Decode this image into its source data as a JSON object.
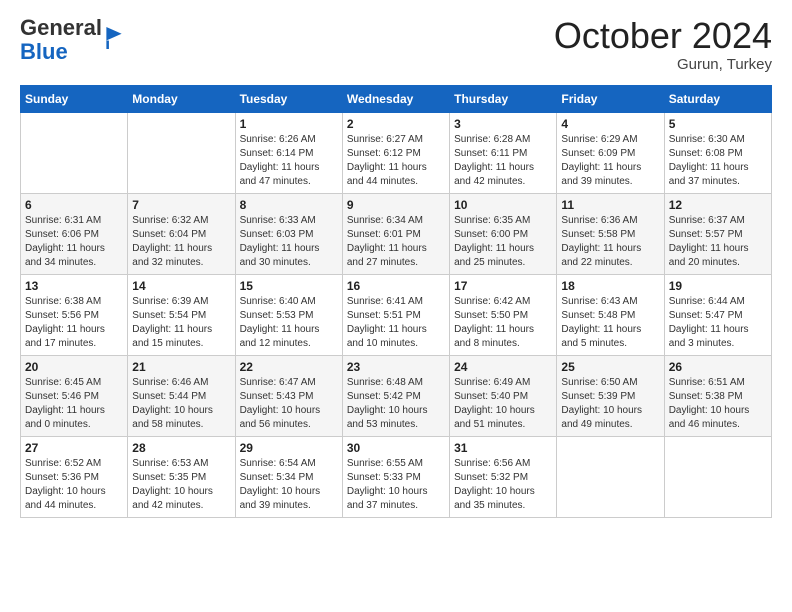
{
  "logo": {
    "general": "General",
    "blue": "Blue"
  },
  "header": {
    "month": "October 2024",
    "location": "Gurun, Turkey"
  },
  "weekdays": [
    "Sunday",
    "Monday",
    "Tuesday",
    "Wednesday",
    "Thursday",
    "Friday",
    "Saturday"
  ],
  "weeks": [
    [
      {
        "day": "",
        "sunrise": "",
        "sunset": "",
        "daylight": ""
      },
      {
        "day": "",
        "sunrise": "",
        "sunset": "",
        "daylight": ""
      },
      {
        "day": "1",
        "sunrise": "Sunrise: 6:26 AM",
        "sunset": "Sunset: 6:14 PM",
        "daylight": "Daylight: 11 hours and 47 minutes."
      },
      {
        "day": "2",
        "sunrise": "Sunrise: 6:27 AM",
        "sunset": "Sunset: 6:12 PM",
        "daylight": "Daylight: 11 hours and 44 minutes."
      },
      {
        "day": "3",
        "sunrise": "Sunrise: 6:28 AM",
        "sunset": "Sunset: 6:11 PM",
        "daylight": "Daylight: 11 hours and 42 minutes."
      },
      {
        "day": "4",
        "sunrise": "Sunrise: 6:29 AM",
        "sunset": "Sunset: 6:09 PM",
        "daylight": "Daylight: 11 hours and 39 minutes."
      },
      {
        "day": "5",
        "sunrise": "Sunrise: 6:30 AM",
        "sunset": "Sunset: 6:08 PM",
        "daylight": "Daylight: 11 hours and 37 minutes."
      }
    ],
    [
      {
        "day": "6",
        "sunrise": "Sunrise: 6:31 AM",
        "sunset": "Sunset: 6:06 PM",
        "daylight": "Daylight: 11 hours and 34 minutes."
      },
      {
        "day": "7",
        "sunrise": "Sunrise: 6:32 AM",
        "sunset": "Sunset: 6:04 PM",
        "daylight": "Daylight: 11 hours and 32 minutes."
      },
      {
        "day": "8",
        "sunrise": "Sunrise: 6:33 AM",
        "sunset": "Sunset: 6:03 PM",
        "daylight": "Daylight: 11 hours and 30 minutes."
      },
      {
        "day": "9",
        "sunrise": "Sunrise: 6:34 AM",
        "sunset": "Sunset: 6:01 PM",
        "daylight": "Daylight: 11 hours and 27 minutes."
      },
      {
        "day": "10",
        "sunrise": "Sunrise: 6:35 AM",
        "sunset": "Sunset: 6:00 PM",
        "daylight": "Daylight: 11 hours and 25 minutes."
      },
      {
        "day": "11",
        "sunrise": "Sunrise: 6:36 AM",
        "sunset": "Sunset: 5:58 PM",
        "daylight": "Daylight: 11 hours and 22 minutes."
      },
      {
        "day": "12",
        "sunrise": "Sunrise: 6:37 AM",
        "sunset": "Sunset: 5:57 PM",
        "daylight": "Daylight: 11 hours and 20 minutes."
      }
    ],
    [
      {
        "day": "13",
        "sunrise": "Sunrise: 6:38 AM",
        "sunset": "Sunset: 5:56 PM",
        "daylight": "Daylight: 11 hours and 17 minutes."
      },
      {
        "day": "14",
        "sunrise": "Sunrise: 6:39 AM",
        "sunset": "Sunset: 5:54 PM",
        "daylight": "Daylight: 11 hours and 15 minutes."
      },
      {
        "day": "15",
        "sunrise": "Sunrise: 6:40 AM",
        "sunset": "Sunset: 5:53 PM",
        "daylight": "Daylight: 11 hours and 12 minutes."
      },
      {
        "day": "16",
        "sunrise": "Sunrise: 6:41 AM",
        "sunset": "Sunset: 5:51 PM",
        "daylight": "Daylight: 11 hours and 10 minutes."
      },
      {
        "day": "17",
        "sunrise": "Sunrise: 6:42 AM",
        "sunset": "Sunset: 5:50 PM",
        "daylight": "Daylight: 11 hours and 8 minutes."
      },
      {
        "day": "18",
        "sunrise": "Sunrise: 6:43 AM",
        "sunset": "Sunset: 5:48 PM",
        "daylight": "Daylight: 11 hours and 5 minutes."
      },
      {
        "day": "19",
        "sunrise": "Sunrise: 6:44 AM",
        "sunset": "Sunset: 5:47 PM",
        "daylight": "Daylight: 11 hours and 3 minutes."
      }
    ],
    [
      {
        "day": "20",
        "sunrise": "Sunrise: 6:45 AM",
        "sunset": "Sunset: 5:46 PM",
        "daylight": "Daylight: 11 hours and 0 minutes."
      },
      {
        "day": "21",
        "sunrise": "Sunrise: 6:46 AM",
        "sunset": "Sunset: 5:44 PM",
        "daylight": "Daylight: 10 hours and 58 minutes."
      },
      {
        "day": "22",
        "sunrise": "Sunrise: 6:47 AM",
        "sunset": "Sunset: 5:43 PM",
        "daylight": "Daylight: 10 hours and 56 minutes."
      },
      {
        "day": "23",
        "sunrise": "Sunrise: 6:48 AM",
        "sunset": "Sunset: 5:42 PM",
        "daylight": "Daylight: 10 hours and 53 minutes."
      },
      {
        "day": "24",
        "sunrise": "Sunrise: 6:49 AM",
        "sunset": "Sunset: 5:40 PM",
        "daylight": "Daylight: 10 hours and 51 minutes."
      },
      {
        "day": "25",
        "sunrise": "Sunrise: 6:50 AM",
        "sunset": "Sunset: 5:39 PM",
        "daylight": "Daylight: 10 hours and 49 minutes."
      },
      {
        "day": "26",
        "sunrise": "Sunrise: 6:51 AM",
        "sunset": "Sunset: 5:38 PM",
        "daylight": "Daylight: 10 hours and 46 minutes."
      }
    ],
    [
      {
        "day": "27",
        "sunrise": "Sunrise: 6:52 AM",
        "sunset": "Sunset: 5:36 PM",
        "daylight": "Daylight: 10 hours and 44 minutes."
      },
      {
        "day": "28",
        "sunrise": "Sunrise: 6:53 AM",
        "sunset": "Sunset: 5:35 PM",
        "daylight": "Daylight: 10 hours and 42 minutes."
      },
      {
        "day": "29",
        "sunrise": "Sunrise: 6:54 AM",
        "sunset": "Sunset: 5:34 PM",
        "daylight": "Daylight: 10 hours and 39 minutes."
      },
      {
        "day": "30",
        "sunrise": "Sunrise: 6:55 AM",
        "sunset": "Sunset: 5:33 PM",
        "daylight": "Daylight: 10 hours and 37 minutes."
      },
      {
        "day": "31",
        "sunrise": "Sunrise: 6:56 AM",
        "sunset": "Sunset: 5:32 PM",
        "daylight": "Daylight: 10 hours and 35 minutes."
      },
      {
        "day": "",
        "sunrise": "",
        "sunset": "",
        "daylight": ""
      },
      {
        "day": "",
        "sunrise": "",
        "sunset": "",
        "daylight": ""
      }
    ]
  ]
}
